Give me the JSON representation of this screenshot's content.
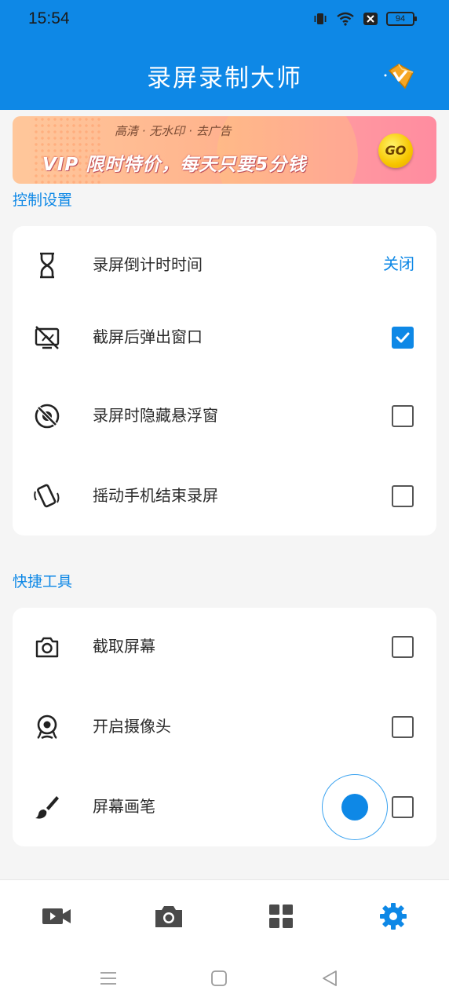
{
  "status_bar": {
    "time": "15:54",
    "battery": "94",
    "icons": [
      "vibrate-icon",
      "wifi-icon",
      "notification-icon",
      "battery-icon"
    ]
  },
  "header": {
    "title": "录屏录制大师",
    "vip_icon": "vip-diamond-icon"
  },
  "banner": {
    "subtitle": "高清 · 无水印 · 去广告",
    "headline": "VIP 限时特价，每天只要5分钱",
    "go_label": "GO"
  },
  "control_section": {
    "title": "控制设置",
    "items": [
      {
        "icon": "hourglass-icon",
        "label": "录屏倒计时时间",
        "value": "关闭"
      },
      {
        "icon": "screenshot-popup-off-icon",
        "label": "截屏后弹出窗口",
        "checked": true
      },
      {
        "icon": "hide-float-icon",
        "label": "录屏时隐藏悬浮窗",
        "checked": false
      },
      {
        "icon": "shake-phone-icon",
        "label": "摇动手机结束录屏",
        "checked": false
      }
    ]
  },
  "tools_section": {
    "title": "快捷工具",
    "items": [
      {
        "icon": "camera-icon",
        "label": "截取屏幕",
        "checked": false
      },
      {
        "icon": "webcam-icon",
        "label": "开启摄像头",
        "checked": false
      },
      {
        "icon": "brush-icon",
        "label": "屏幕画笔",
        "checked": false
      }
    ]
  },
  "bottom_nav": {
    "items": [
      {
        "icon": "video-icon",
        "active": false
      },
      {
        "icon": "camera-icon",
        "active": false
      },
      {
        "icon": "grid-icon",
        "active": false
      },
      {
        "icon": "settings-icon",
        "active": true
      }
    ]
  },
  "colors": {
    "accent": "#0e88e6",
    "inactive_icon": "#4a4a4a"
  }
}
